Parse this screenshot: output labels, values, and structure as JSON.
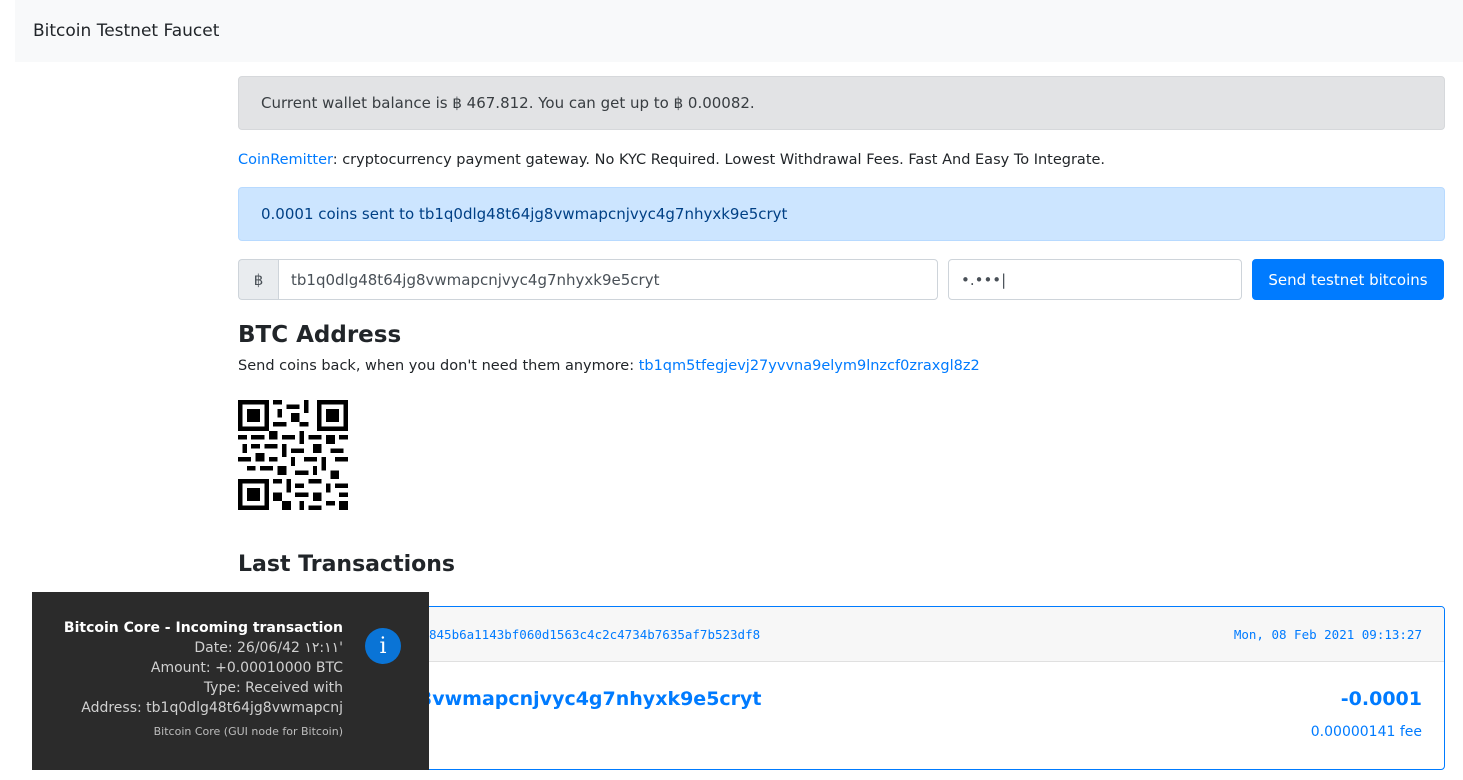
{
  "navbar": {
    "brand": "Bitcoin Testnet Faucet"
  },
  "balance_alert": {
    "text": "Current wallet balance is ฿ 467.812. You can get up to ฿ 0.00082."
  },
  "promo": {
    "link_text": "CoinRemitter",
    "text": ": cryptocurrency payment gateway. No KYC Required. Lowest Withdrawal Fees. Fast And Easy To Integrate."
  },
  "sent_alert": {
    "text": "0.0001 coins sent to tb1q0dlg48t64jg8vwmapcnjvyc4g7nhyxk9e5cryt"
  },
  "form": {
    "currency_symbol": "฿",
    "address_value": "tb1q0dlg48t64jg8vwmapcnjvyc4g7nhyxk9e5cryt",
    "captcha_value": "•.•••|",
    "send_label": "Send testnet bitcoins"
  },
  "btc_address": {
    "heading": "BTC Address",
    "send_back_text": "Send coins back, when you don't need them anymore: ",
    "return_address": "tb1qm5tfegjevj27yvvna9elym9lnzcf0zraxgl8z2"
  },
  "last_transactions": {
    "heading": "Last Transactions",
    "items": [
      {
        "txid_visible": "845b6a1143bf060d1563c4c2c4734b7635af7b523df8",
        "date": "Mon, 08 Feb 2021 09:13:27",
        "address_visible": "3vwmapcnjvyc4g7nhyxk9e5cryt",
        "amount": "-0.0001",
        "fee": "0.00000141 fee"
      }
    ]
  },
  "notification": {
    "title": "Bitcoin Core - Incoming transaction",
    "date_line": "Date: 26/06/42 ١٢:١١'",
    "amount_line": "Amount: +0.00010000 BTC",
    "type_line": "Type: Received with",
    "address_line": "Address: tb1q0dlg48t64jg8vwmapcnj",
    "app_line": "Bitcoin Core (GUI node for Bitcoin)",
    "icon": "info-icon",
    "icon_color": "#0a74d6"
  }
}
